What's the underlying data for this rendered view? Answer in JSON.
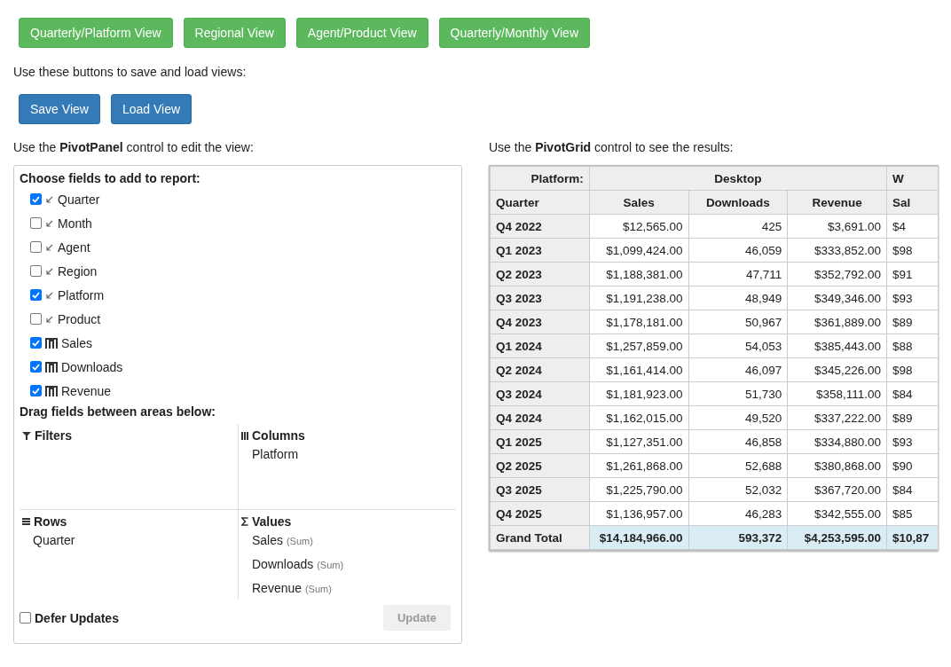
{
  "view_buttons": [
    "Quarterly/Platform View",
    "Regional View",
    "Agent/Product View",
    "Quarterly/Monthly View"
  ],
  "save_hint": "Use these buttons to save and load views:",
  "save_buttons": [
    "Save View",
    "Load View"
  ],
  "panel_hint": "Use the **PivotPanel** control to edit the view:",
  "grid_hint": "Use the **PivotGrid** control to see the results:",
  "panel": {
    "choose_title": "Choose fields to add to report:",
    "fields": [
      {
        "label": "Quarter",
        "kind": "dimension",
        "checked": true
      },
      {
        "label": "Month",
        "kind": "dimension",
        "checked": false
      },
      {
        "label": "Agent",
        "kind": "dimension",
        "checked": false
      },
      {
        "label": "Region",
        "kind": "dimension",
        "checked": false
      },
      {
        "label": "Platform",
        "kind": "dimension",
        "checked": true
      },
      {
        "label": "Product",
        "kind": "dimension",
        "checked": false
      },
      {
        "label": "Sales",
        "kind": "measure",
        "checked": true
      },
      {
        "label": "Downloads",
        "kind": "measure",
        "checked": true
      },
      {
        "label": "Revenue",
        "kind": "measure",
        "checked": true
      }
    ],
    "drag_title": "Drag fields between areas below:",
    "areas": [
      {
        "kind": "filters",
        "title": "Filters"
      },
      {
        "kind": "columns",
        "title": "Columns",
        "items": [
          {
            "name": "Platform"
          }
        ]
      },
      {
        "kind": "rows",
        "title": "Rows",
        "items": [
          {
            "name": "Quarter"
          }
        ]
      },
      {
        "kind": "values",
        "title": "Values",
        "items": [
          {
            "name": "Sales",
            "aggregate": "(Sum)"
          },
          {
            "name": "Downloads",
            "aggregate": "(Sum)"
          },
          {
            "name": "Revenue",
            "aggregate": "(Sum)"
          }
        ]
      }
    ],
    "defer": {
      "label": "Defer Updates",
      "checked": false
    },
    "update": {
      "label": "Update",
      "disabled": true
    }
  },
  "grid": {
    "corner": "Platform:",
    "groups": [
      "Desktop",
      "W"
    ],
    "row_header": "Quarter",
    "columns": [
      "Sales",
      "Downloads",
      "Revenue",
      "Sal"
    ],
    "rows": [
      {
        "label": "Q4 2022",
        "cells": [
          "$12,565.00",
          "425",
          "$3,691.00",
          "$4"
        ]
      },
      {
        "label": "Q1 2023",
        "cells": [
          "$1,099,424.00",
          "46,059",
          "$333,852.00",
          "$98"
        ]
      },
      {
        "label": "Q2 2023",
        "cells": [
          "$1,188,381.00",
          "47,711",
          "$352,792.00",
          "$91"
        ]
      },
      {
        "label": "Q3 2023",
        "cells": [
          "$1,191,238.00",
          "48,949",
          "$349,346.00",
          "$93"
        ]
      },
      {
        "label": "Q4 2023",
        "cells": [
          "$1,178,181.00",
          "50,967",
          "$361,889.00",
          "$89"
        ]
      },
      {
        "label": "Q1 2024",
        "cells": [
          "$1,257,859.00",
          "54,053",
          "$385,443.00",
          "$88"
        ]
      },
      {
        "label": "Q2 2024",
        "cells": [
          "$1,161,414.00",
          "46,097",
          "$345,226.00",
          "$98"
        ]
      },
      {
        "label": "Q3 2024",
        "cells": [
          "$1,181,923.00",
          "51,730",
          "$358,111.00",
          "$84"
        ]
      },
      {
        "label": "Q4 2024",
        "cells": [
          "$1,162,015.00",
          "49,520",
          "$337,222.00",
          "$89"
        ]
      },
      {
        "label": "Q1 2025",
        "cells": [
          "$1,127,351.00",
          "46,858",
          "$334,880.00",
          "$93"
        ]
      },
      {
        "label": "Q2 2025",
        "cells": [
          "$1,261,868.00",
          "52,688",
          "$380,868.00",
          "$90"
        ]
      },
      {
        "label": "Q3 2025",
        "cells": [
          "$1,225,790.00",
          "52,032",
          "$367,720.00",
          "$84"
        ]
      },
      {
        "label": "Q4 2025",
        "cells": [
          "$1,136,957.00",
          "46,283",
          "$342,555.00",
          "$85"
        ]
      }
    ],
    "total": {
      "label": "Grand Total",
      "cells": [
        "$14,184,966.00",
        "593,372",
        "$4,253,595.00",
        "$10,87"
      ]
    }
  }
}
